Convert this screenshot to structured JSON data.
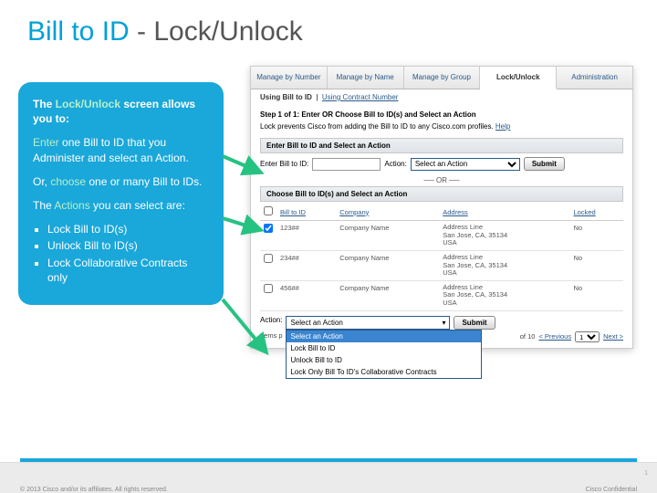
{
  "title": {
    "part1": "Bill to ID",
    "sep": " - ",
    "part2": "Lock/Unlock"
  },
  "callout": {
    "line1a": "The ",
    "line1b": "Lock/Unlock",
    "line1c": " screen allows you to:",
    "line2a": "Enter",
    "line2b": " one Bill to ID that you Administer and select an Action.",
    "line3a": "Or, ",
    "line3b": "choose",
    "line3c": " one or many Bill to IDs.",
    "line4a": "The ",
    "line4b": "Actions",
    "line4c": " you can select are:",
    "bullets": [
      "Lock Bill to ID(s)",
      "Unlock Bill to ID(s)",
      "Lock Collaborative Contracts only"
    ]
  },
  "tabs": [
    "Manage by Number",
    "Manage by Name",
    "Manage by Group",
    "Lock/Unlock",
    "Administration"
  ],
  "subtab": {
    "lead": "Using Bill to ID",
    "link": "Using Contract Number"
  },
  "step": "Step 1 of 1: Enter OR Choose Bill to ID(s) and Select an Action",
  "note": {
    "text": "Lock prevents Cisco from adding the Bill to ID to any Cisco.com profiles.",
    "help": "Help"
  },
  "sec1": "Enter Bill to ID and Select an Action",
  "enter": {
    "label": "Enter Bill to ID:",
    "action": "Action:",
    "selected": "Select an Action",
    "submit": "Submit"
  },
  "or": "OR",
  "sec2": "Choose Bill to ID(s) and Select an Action",
  "cols": [
    "Bill to ID",
    "Company",
    "Address",
    "Locked"
  ],
  "rows": [
    {
      "id": "123##",
      "company": "Company Name",
      "addr": "Address Line\nSan Jose, CA, 35134\nUSA",
      "locked": "No",
      "checked": true
    },
    {
      "id": "234##",
      "company": "Company Name",
      "addr": "Address Line\nSan Jose, CA, 35134\nUSA",
      "locked": "No",
      "checked": false
    },
    {
      "id": "456##",
      "company": "Company Name",
      "addr": "Address Line\nSan Jose, CA, 35134\nUSA",
      "locked": "No",
      "checked": false
    }
  ],
  "action2": {
    "label": "Action:",
    "selected": "Select an Action",
    "submit": "Submit",
    "options": [
      "Select an Action",
      "Lock Bill to ID",
      "Unlock Bill to ID",
      "Lock Only Bill To ID's Collaborative Contracts"
    ]
  },
  "items": {
    "prefix": "Items p",
    "of": "of 10",
    "prev": "< Previous",
    "page": "1",
    "next": "Next >"
  },
  "footer": {
    "copyright": "© 2013 Cisco and/or its affiliates. All rights reserved.",
    "conf": "Cisco Confidential",
    "page": "1"
  }
}
